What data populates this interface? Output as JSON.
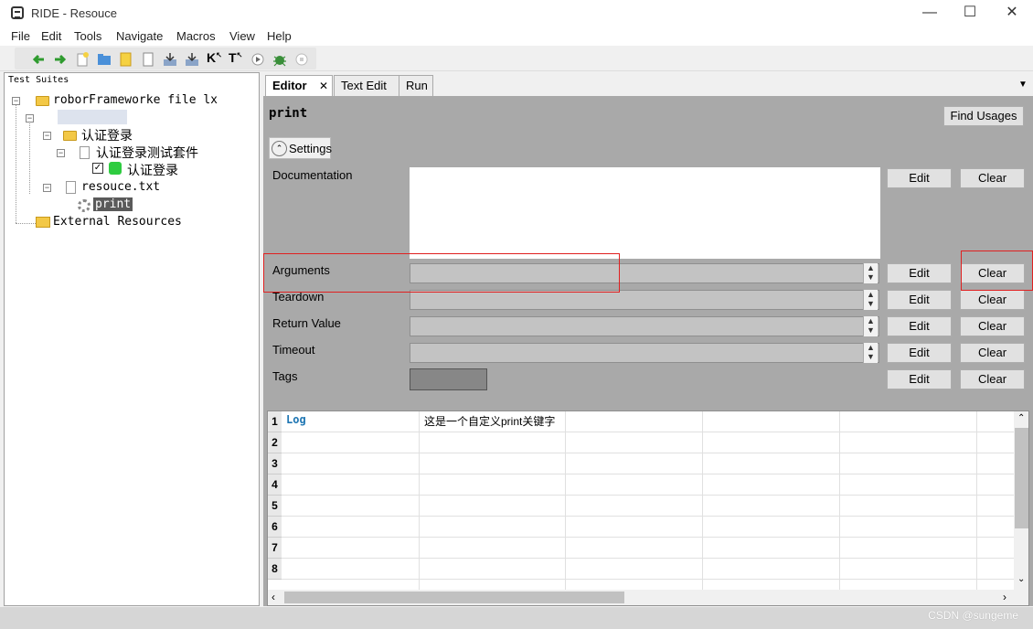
{
  "window": {
    "title": "RIDE - Resouce"
  },
  "menu": [
    "File",
    "Edit",
    "Tools",
    "Navigate",
    "Macros",
    "View",
    "Help"
  ],
  "tree": {
    "header": "Test Suites",
    "root": "roborFrameworke file lx",
    "folder": "认证登录",
    "suite": "认证登录测试套件",
    "testcase": "认证登录",
    "resource": "resouce.txt",
    "keyword": "print",
    "external": "External Resources"
  },
  "tabs": [
    "Editor",
    "Text Edit",
    "Run"
  ],
  "editor": {
    "keyword_name": "print",
    "find_usages": "Find Usages",
    "settings": "Settings",
    "edit": "Edit",
    "clear": "Clear",
    "labels": {
      "documentation": "Documentation",
      "arguments": "Arguments",
      "teardown": "Teardown",
      "return_value": "Return Value",
      "timeout": "Timeout",
      "tags": "Tags"
    }
  },
  "grid": {
    "rows": [
      "1",
      "2",
      "3",
      "4",
      "5",
      "6",
      "7",
      "8"
    ],
    "row1_keyword": "Log",
    "row1_arg": "这是一个自定义print关键字"
  },
  "watermark": "CSDN @sungeme",
  "colors": {
    "keyword_blue": "#1f76b3",
    "highlight_red": "#e02020",
    "panel_gray": "#a9a9a9"
  }
}
